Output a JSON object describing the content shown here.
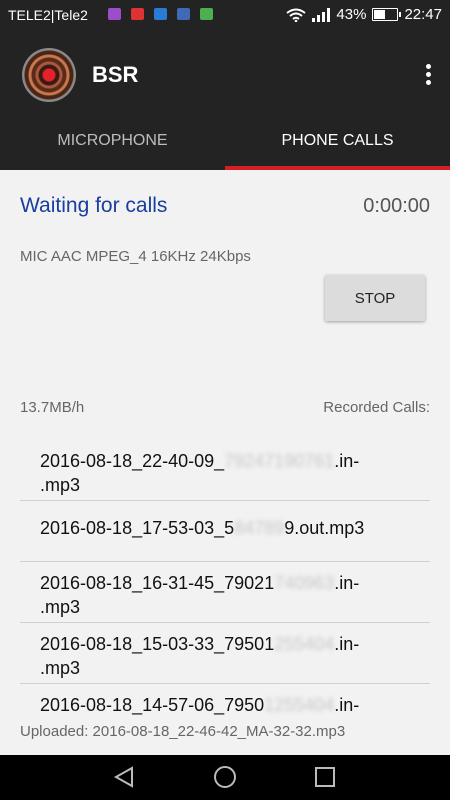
{
  "status_bar": {
    "carrier": "TELE2|Tele2",
    "battery_percent": "43%",
    "battery_level": 0.43,
    "time": "22:47"
  },
  "app": {
    "title": "BSR"
  },
  "tabs": [
    {
      "label": "MICROPHONE",
      "selected": false
    },
    {
      "label": "PHONE CALLS",
      "selected": true
    }
  ],
  "recorder": {
    "status": "Waiting for calls",
    "timer": "0:00:00",
    "codec": "MIC AAC MPEG_4 16KHz 24Kbps",
    "stop_label": "STOP",
    "rate": "13.7MB/h",
    "recorded_label": "Recorded Calls:"
  },
  "recordings": [
    {
      "prefix": "2016-08-18_22-40-09_",
      "hidden": "79247190761",
      "suffix": ".in-\n.mp3"
    },
    {
      "prefix": "2016-08-18_17-53-03_5",
      "hidden": "84789",
      "suffix": "9.out.mp3"
    },
    {
      "prefix": "2016-08-18_16-31-45_79021",
      "hidden": "740963",
      "suffix": ".in-\n.mp3"
    },
    {
      "prefix": "2016-08-18_15-03-33_79501",
      "hidden": "255404",
      "suffix": ".in-\n.mp3"
    },
    {
      "prefix": "2016-08-18_14-57-06_7950",
      "hidden": "1255404",
      "suffix": ".in-"
    }
  ],
  "uploaded": "Uploaded: 2016-08-18_22-46-42_MA-32-32.mp3",
  "colors": {
    "accent": "#d61e24",
    "status_text": "#1a3ea0",
    "app_bar": "#232323"
  },
  "icons": {
    "overflow": "more-vert-icon",
    "back": "back-triangle-icon",
    "home": "home-circle-icon",
    "recents": "recents-square-icon"
  }
}
